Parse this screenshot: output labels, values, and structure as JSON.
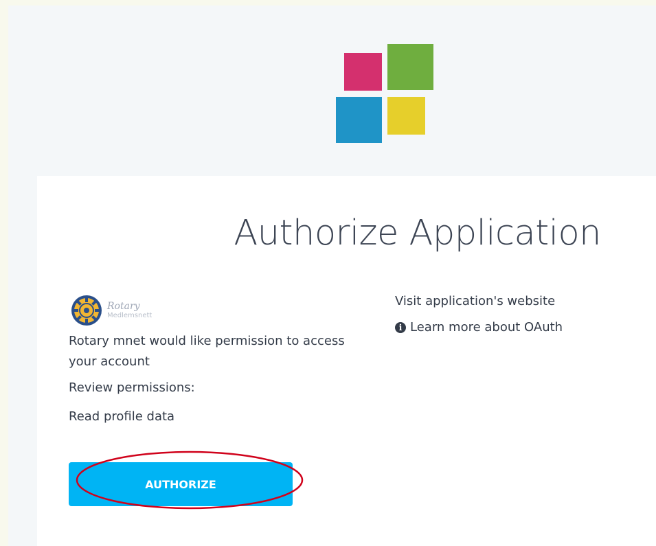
{
  "page": {
    "background_color": "#f4f7f9"
  },
  "brand": {
    "logo_colors": [
      "#d4306e",
      "#6fae3f",
      "#1f94c7",
      "#e6cf2b"
    ]
  },
  "card": {
    "title": "Authorize Application"
  },
  "app": {
    "logo_name": "Rotary",
    "logo_subtitle": "Medlemsnett",
    "permission_message": "Rotary mnet would like permission to access your account",
    "review_label": "Review permissions:",
    "permissions": [
      "Read profile data"
    ]
  },
  "actions": {
    "authorize_label": "AUTHORIZE",
    "authorize_color": "#00b4f4"
  },
  "links": {
    "visit_website": "Visit application's website",
    "learn_more": "Learn more about OAuth",
    "info_icon": "info-circle-icon"
  },
  "annotation": {
    "color": "#d0021b"
  }
}
